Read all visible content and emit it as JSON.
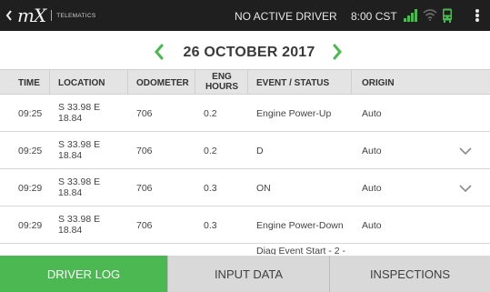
{
  "header": {
    "logo_mark": "mX",
    "logo_sub": "TELEMATICS",
    "driver_status": "NO ACTIVE DRIVER",
    "time": "8:00 CST",
    "icons": [
      "back-chevron-icon",
      "signal-bars-icon",
      "wifi-icon",
      "bus-icon",
      "overflow-menu-icon"
    ],
    "accent_color": "#4cb852"
  },
  "date_nav": {
    "title": "26 OCTOBER 2017",
    "prev_icon": "chevron-left-icon",
    "next_icon": "chevron-right-icon"
  },
  "table": {
    "columns": [
      "TIME",
      "LOCATION",
      "ODOMETER",
      "ENG HOURS",
      "EVENT / STATUS",
      "ORIGIN"
    ],
    "rows": [
      {
        "time": "09:25",
        "location_line1": "S 33.98 E",
        "location_line2": "18.84",
        "odometer": "706",
        "eng_hours": "0.2",
        "event": "Engine Power-Up",
        "origin": "Auto",
        "expandable": false
      },
      {
        "time": "09:25",
        "location_line1": "S 33.98 E",
        "location_line2": "18.84",
        "odometer": "706",
        "eng_hours": "0.2",
        "event": "D",
        "origin": "Auto",
        "expandable": true
      },
      {
        "time": "09:29",
        "location_line1": "S 33.98 E",
        "location_line2": "18.84",
        "odometer": "706",
        "eng_hours": "0.3",
        "event": "ON",
        "origin": "Auto",
        "expandable": true
      },
      {
        "time": "09:29",
        "location_line1": "S 33.98 E",
        "location_line2": "18.84",
        "odometer": "706",
        "eng_hours": "0.3",
        "event": "Engine Power-Down",
        "origin": "Auto",
        "expandable": false
      },
      {
        "time": "",
        "location_line1": "",
        "location_line2": "",
        "odometer": "",
        "eng_hours": "",
        "event": "Diag Event Start - 2 -",
        "origin": "",
        "expandable": false
      }
    ]
  },
  "tabs": [
    {
      "label": "DRIVER LOG",
      "active": true
    },
    {
      "label": "INPUT DATA",
      "active": false
    },
    {
      "label": "INSPECTIONS",
      "active": false
    }
  ]
}
